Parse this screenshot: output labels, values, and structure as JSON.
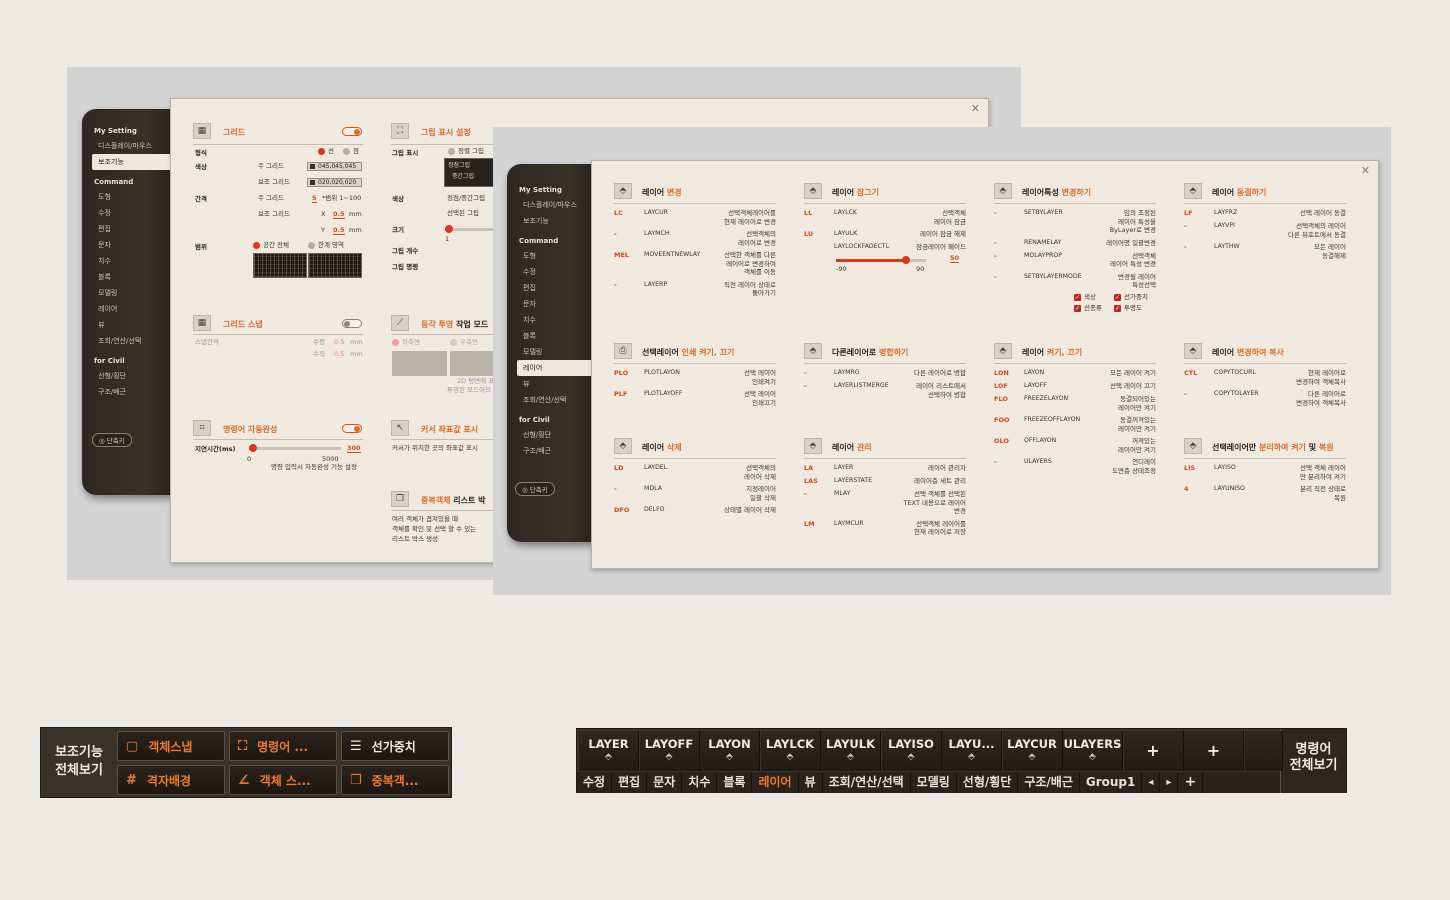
{
  "left_window": {
    "sidebar": {
      "group_my": "My Setting",
      "my_items": [
        "디스플레이/마우스",
        "보조기능"
      ],
      "group_cmd": "Command",
      "cmd_items": [
        "도형",
        "수정",
        "편집",
        "문자",
        "치수",
        "블록",
        "모델링",
        "레이어",
        "뷰",
        "조회/연산/선택"
      ],
      "group_civil": "for Civil",
      "civil_items": [
        "선형/횡단",
        "구조/배근"
      ],
      "shortcut": "단축키"
    },
    "grid": {
      "title": "그리드",
      "form_label": "형식",
      "form_opt1": "선",
      "form_opt2": "점",
      "color_label": "색상",
      "main_grid": "주 그리드",
      "main_color": "045,045,045",
      "sub_grid": "보조 그리드",
      "sub_color": "020,020,020",
      "spacing_label": "간격",
      "main_grid2": "주 그리드",
      "main_val": "5",
      "main_range": "*범위 1~100",
      "sub_grid2": "보조 그리드",
      "x_label": "X",
      "x_val": "0.5",
      "y_label": "Y",
      "y_val": "0.5",
      "unit": "mm",
      "range_label": "범위",
      "range_opt1": "공간 전체",
      "range_opt2": "한계 영역"
    },
    "grip": {
      "title": "그립 표시 설정",
      "display_label": "그립 표시",
      "display_opt": "정렬 그립",
      "preview1": "정점그립",
      "preview2": "중간그립",
      "color_label": "색상",
      "color_val1": "정점/중간그립",
      "color_val2": "선택된 그립",
      "size_label": "크기",
      "size_val": "1",
      "count_label": "그립 개수",
      "cmd_label": "그립 명령"
    },
    "snap": {
      "title": "그리드 스냅",
      "spacing": "스냅간격",
      "h_label": "수평",
      "h_val": "0.5",
      "v_label": "수직",
      "v_val": "0.5",
      "unit": "mm"
    },
    "iso": {
      "title_orange": "등각 투영",
      "title_black": "작업 모드",
      "opt1": "좌측면",
      "opt2": "우측면",
      "note1": "2D 평면에 표",
      "note2": "투영된 모드이므"
    },
    "autocomplete": {
      "title": "명령어 자동완성",
      "delay_label": "지연시간(ms)",
      "delay_val": "300",
      "min": "0",
      "max": "5000",
      "desc": "명령 입력시 자동완성 기능 설정"
    },
    "cursor": {
      "title": "커서 좌표값 표시",
      "desc": "커서가 위치한 곳의 좌표값 표시"
    },
    "dup": {
      "title_orange": "중복객체",
      "title_black": "리스트 박",
      "desc1": "여러 객체가 겹쳐있을 때",
      "desc2": "객체를 확인 및 선택 할 수 있는",
      "desc3": "리스트 박스 생성"
    }
  },
  "right_window": {
    "sidebar": {
      "group_my": "My Setting",
      "my_items": [
        "디스플레이/마우스",
        "보조기능"
      ],
      "group_cmd": "Command",
      "cmd_items": [
        "도형",
        "수정",
        "편집",
        "문자",
        "치수",
        "블록",
        "모델링",
        "레이어",
        "뷰",
        "조회/연산/선택"
      ],
      "group_civil": "for Civil",
      "civil_items": [
        "선형/횡단",
        "구조/배근"
      ],
      "shortcut": "단축키"
    },
    "sections": [
      {
        "t1": "레이어",
        "t2": "변경",
        "rows": [
          {
            "a": "LC",
            "c": "LAYCUR",
            "d": "선택객체레이어를\n현재 레이어로 변경"
          },
          {
            "a": "-",
            "c": "LAYMCH",
            "d": "선택객체의\n레이어로 변경"
          },
          {
            "a": "MEL",
            "c": "MOVEENTNEWLAY",
            "d": "선택한 객체를 다른\n레이어로 변경하여\n객체를 이동"
          },
          {
            "a": "-",
            "c": "LAYERP",
            "d": "직전 레이어 상태로\n돌아가기"
          }
        ]
      },
      {
        "t1": "레이어",
        "t2": "잠그기",
        "rows": [
          {
            "a": "LL",
            "c": "LAYLCK",
            "d": "선택객체\n레이어 잠금"
          },
          {
            "a": "LU",
            "c": "LAYULK",
            "d": "레이어 잠금 해제"
          },
          {
            "a": "",
            "c": "LAYLOCKFADECTL",
            "d": "잠금레이어 페이드"
          }
        ],
        "slider": {
          "min": "-90",
          "max": "90",
          "val": "50"
        }
      },
      {
        "t1": "레이어특성",
        "t2": "변경하기",
        "rows": [
          {
            "a": "-",
            "c": "SETBYLAYER",
            "d": "임의 조정된\n레이어 특성을\nByLayer로 변경"
          },
          {
            "a": "-",
            "c": "RENAMELAY",
            "d": "레이어명 일괄변경"
          },
          {
            "a": "-",
            "c": "MOLAYPROP",
            "d": "선택객체\n레이어 특성 변경"
          },
          {
            "a": "-",
            "c": "SETBYLAYERMODE",
            "d": "변경될 레이어\n특성선택"
          }
        ],
        "checks": [
          "색상",
          "선가중치",
          "선종류",
          "투명도"
        ]
      },
      {
        "t1": "레이어",
        "t2": "동결하기",
        "rows": [
          {
            "a": "LF",
            "c": "LAYFRZ",
            "d": "선택 레이어 동결"
          },
          {
            "a": "-",
            "c": "LAYVPI",
            "d": "선택객체의 레이어\n다른 뷰포트에서 동결"
          },
          {
            "a": "-",
            "c": "LAYTHW",
            "d": "모든 레이어\n동결해제"
          }
        ]
      },
      {
        "t1": "선택레이어",
        "t2": "인쇄 켜기, 끄기",
        "rows": [
          {
            "a": "PLO",
            "c": "PLOTLAYON",
            "d": "선택 레이어\n인쇄켜기"
          },
          {
            "a": "PLF",
            "c": "PLOTLAYOFF",
            "d": "선택 레이어\n인쇄끄기"
          }
        ]
      },
      {
        "t1": "다른레이어로",
        "t2": "병합하기",
        "rows": [
          {
            "a": "-",
            "c": "LAYMRG",
            "d": "다른 레이어로 병합"
          },
          {
            "a": "-",
            "c": "LAYERLISTMERGE",
            "d": "레이어 리스트에서\n선택하여 병합"
          }
        ]
      },
      {
        "t1": "레이어",
        "t2": "켜기, 끄기",
        "rows": [
          {
            "a": "LON",
            "c": "LAYON",
            "d": "모든 레이어 켜기"
          },
          {
            "a": "LOF",
            "c": "LAYOFF",
            "d": "선택 레이어 끄기"
          },
          {
            "a": "FLO",
            "c": "FREEZELAYON",
            "d": "동결되어있는\n레이어만 켜기"
          },
          {
            "a": "FOO",
            "c": "FREEZEOFFLAYON",
            "d": "동결꺼져있는\n레이어만 켜기"
          },
          {
            "a": "OLO",
            "c": "OFFLAYON",
            "d": "꺼져있는\n레이어만 켜기"
          },
          {
            "a": "-",
            "c": "ULAYERS",
            "d": "언디레이\n도면층 상태조정"
          }
        ]
      },
      {
        "t1": "레이어",
        "t2": "변경하여 복사",
        "rows": [
          {
            "a": "CTL",
            "c": "COPYTOCURL",
            "d": "현재 레이어로\n변경하여 객체복사"
          },
          {
            "a": "-",
            "c": "COPYTOLAYER",
            "d": "다른 레이어로\n변경하여 객체복사"
          }
        ]
      },
      {
        "t1": "레이어",
        "t2": "삭제",
        "rows": [
          {
            "a": "LD",
            "c": "LAYDEL",
            "d": "선택객체의\n레이어 삭제"
          },
          {
            "a": "-",
            "c": "MDLA",
            "d": "지정레이어\n일괄 삭제"
          },
          {
            "a": "DFO",
            "c": "DELFO",
            "d": "상태별 레이어 삭제"
          }
        ]
      },
      {
        "t1": "레이어",
        "t2": "관리",
        "rows": [
          {
            "a": "LA",
            "c": "LAYER",
            "d": "레이어 관리자"
          },
          {
            "a": "LAS",
            "c": "LAYERSTATE",
            "d": "레이어층 세트 관리"
          },
          {
            "a": "-",
            "c": "MLAY",
            "d": "선택 객체를 선택된\nTEXT 내용으로 레이어\n변경"
          },
          {
            "a": "LM",
            "c": "LAYMCUR",
            "d": "선택객체 레이어를\n현재 레이어로 저장"
          }
        ]
      },
      {
        "t1": "선택레이어만",
        "t2": "분리하여 켜기",
        "t3": "및",
        "t4": "복원",
        "rows": [
          {
            "a": "LIS",
            "c": "LAYISO",
            "d": "선택 객체 레이어\n만 분리하여 켜기"
          },
          {
            "a": "4",
            "c": "LAYUNISO",
            "d": "분리 직전 상태로\n복원"
          }
        ]
      }
    ]
  },
  "toolbar1": {
    "left_label_1": "보조기능",
    "left_label_2": "전체보기",
    "buttons": [
      "객체스냅",
      "명령어 ...",
      "선가중치",
      "격자배경",
      "객체 스...",
      "중복객..."
    ]
  },
  "toolbar2": {
    "commands": [
      "LAYER",
      "LAYOFF",
      "LAYON",
      "LAYLCK",
      "LAYULK",
      "LAYISO",
      "LAYU...",
      "LAYCUR",
      "ULAYERS"
    ],
    "plus": "+",
    "tabs": [
      "수정",
      "편집",
      "문자",
      "치수",
      "블록",
      "레이어",
      "뷰",
      "조회/연산/선택",
      "모델링",
      "선형/횡단",
      "구조/배근",
      "Group1"
    ],
    "active_tab": "레이어",
    "nav_prev": "◂",
    "nav_next": "▸",
    "right_label_1": "명령어",
    "right_label_2": "전체보기"
  },
  "colors": {
    "accent": "#e06a25",
    "abbr": "#d9461b",
    "dark": "#3a3128",
    "panel": "#efe9df"
  }
}
